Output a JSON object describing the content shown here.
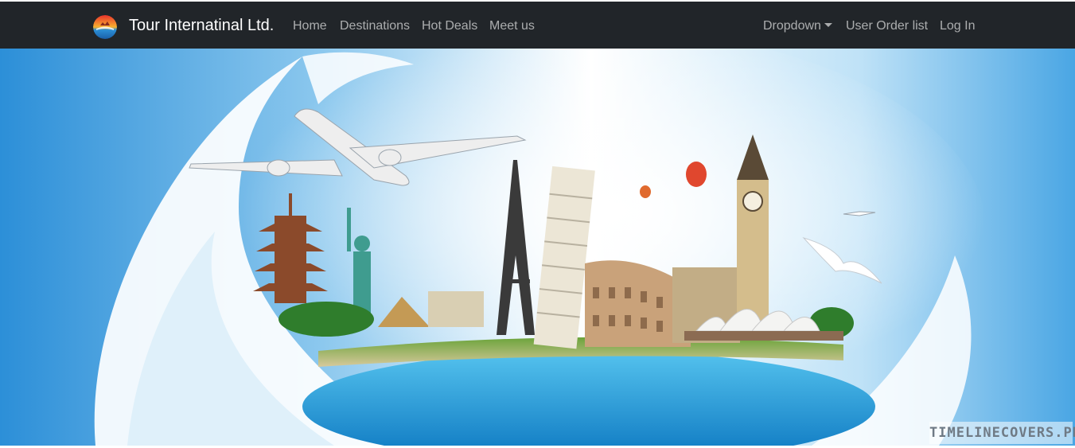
{
  "navbar": {
    "brand": "Tour Internatinal Ltd.",
    "logo_icon": "globe-sunset-logo",
    "links": [
      "Home",
      "Destinations",
      "Hot Deals",
      "Meet us"
    ],
    "right_links": {
      "dropdown": "Dropdown",
      "orders": "User Order list",
      "login": "Log In"
    },
    "colors": {
      "background": "#212529",
      "brand_text": "#ffffff",
      "link_text": "#a6a8aa"
    }
  },
  "hero": {
    "watermark": "TIMELINECOVERS.PRO",
    "image_subject": "travel-landmarks-wave-illustration"
  }
}
